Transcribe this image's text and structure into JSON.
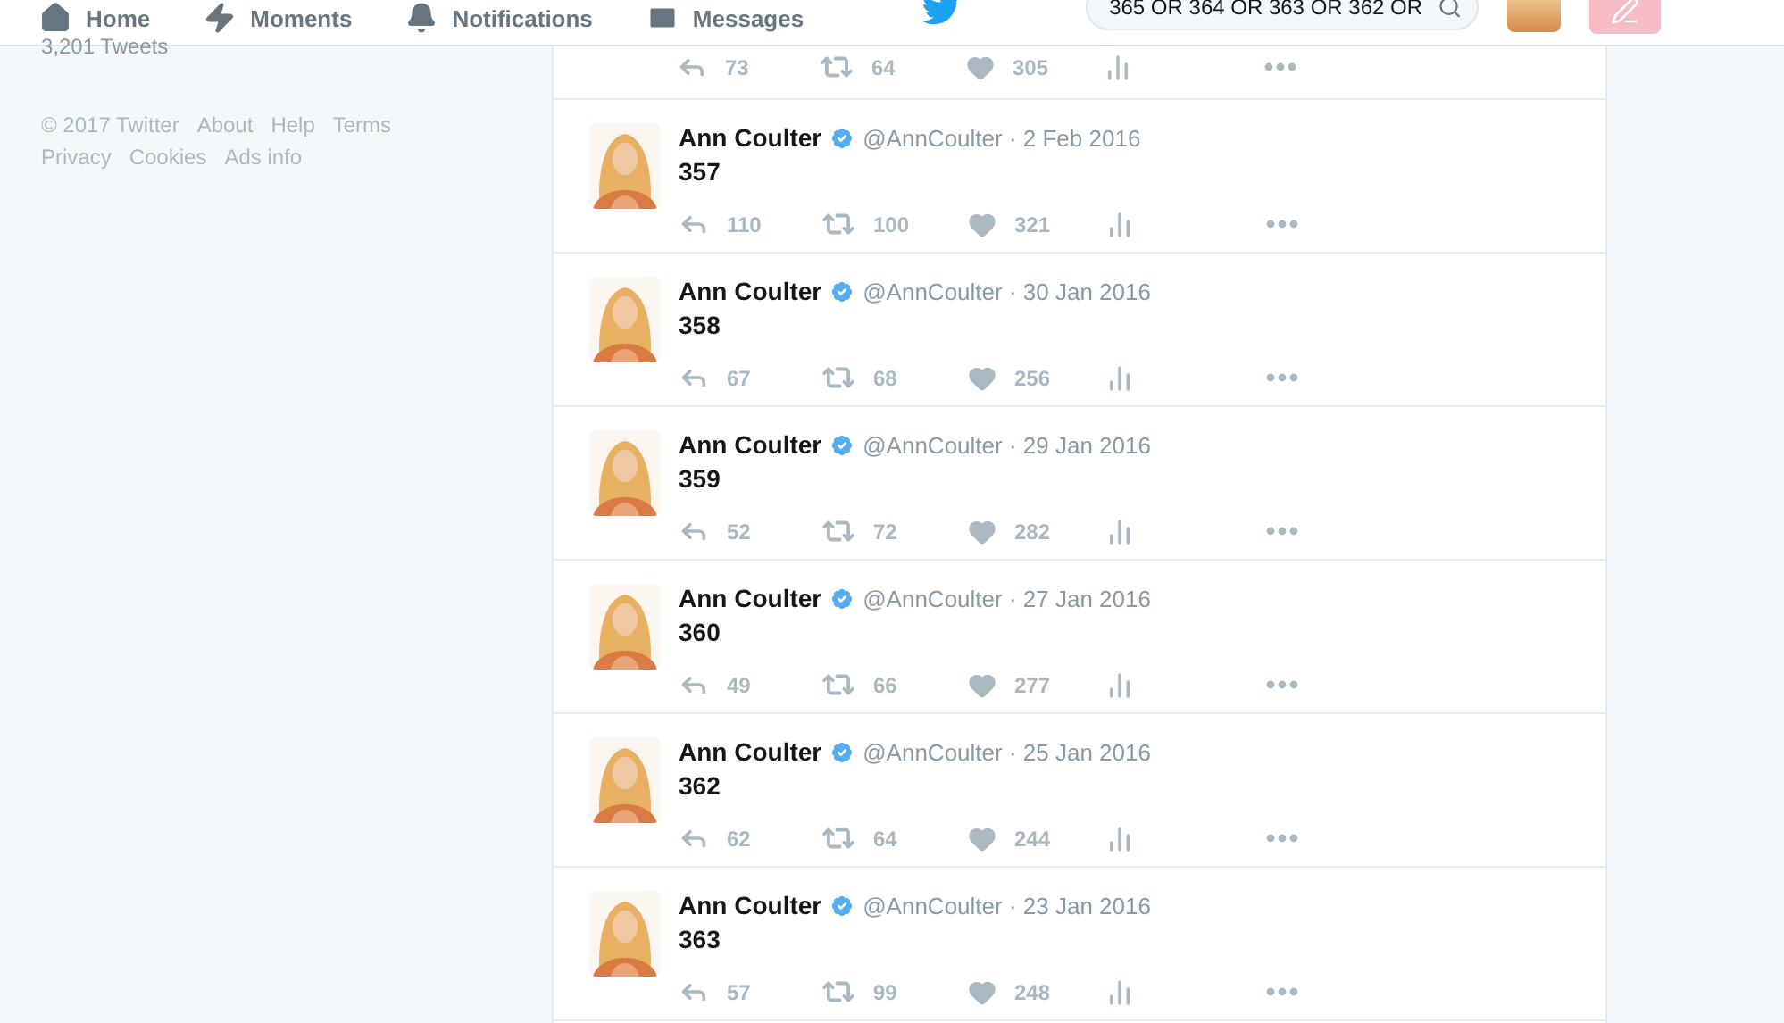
{
  "nav": {
    "items": [
      {
        "label": "Home",
        "kind": "home"
      },
      {
        "label": "Moments",
        "kind": "moments"
      },
      {
        "label": "Notifications",
        "kind": "notifications"
      },
      {
        "label": "Messages",
        "kind": "messages"
      }
    ],
    "search": {
      "value": "365 OR 364 OR 363 OR 362 OR"
    }
  },
  "profile": {
    "tweet_count": "3,201 Tweets"
  },
  "footer_links": [
    "© 2017 Twitter",
    "About",
    "Help",
    "Terms",
    "Privacy",
    "Cookies",
    "Ads info"
  ],
  "top_tweet_actions": {
    "replies": "73",
    "retweets": "64",
    "likes": "305"
  },
  "tweets": [
    {
      "name": "Ann Coulter",
      "meta": "@AnnCoulter · 2 Feb 2016",
      "verified": true,
      "text": "357",
      "replies": "110",
      "retweets": "100",
      "likes": "321"
    },
    {
      "name": "Ann Coulter",
      "meta": "@AnnCoulter · 30 Jan 2016",
      "verified": true,
      "text": "358",
      "replies": "67",
      "retweets": "68",
      "likes": "256"
    },
    {
      "name": "Ann Coulter",
      "meta": "@AnnCoulter · 29 Jan 2016",
      "verified": true,
      "text": "359",
      "replies": "52",
      "retweets": "72",
      "likes": "282"
    },
    {
      "name": "Ann Coulter",
      "meta": "@AnnCoulter · 27 Jan 2016",
      "verified": true,
      "text": "360",
      "replies": "49",
      "retweets": "66",
      "likes": "277"
    },
    {
      "name": "Ann Coulter",
      "meta": "@AnnCoulter · 25 Jan 2016",
      "verified": true,
      "text": "362",
      "replies": "62",
      "retweets": "64",
      "likes": "244"
    },
    {
      "name": "Ann Coulter",
      "meta": "@AnnCoulter · 23 Jan 2016",
      "verified": true,
      "text": "363",
      "replies": "57",
      "retweets": "99",
      "likes": "248"
    }
  ]
}
